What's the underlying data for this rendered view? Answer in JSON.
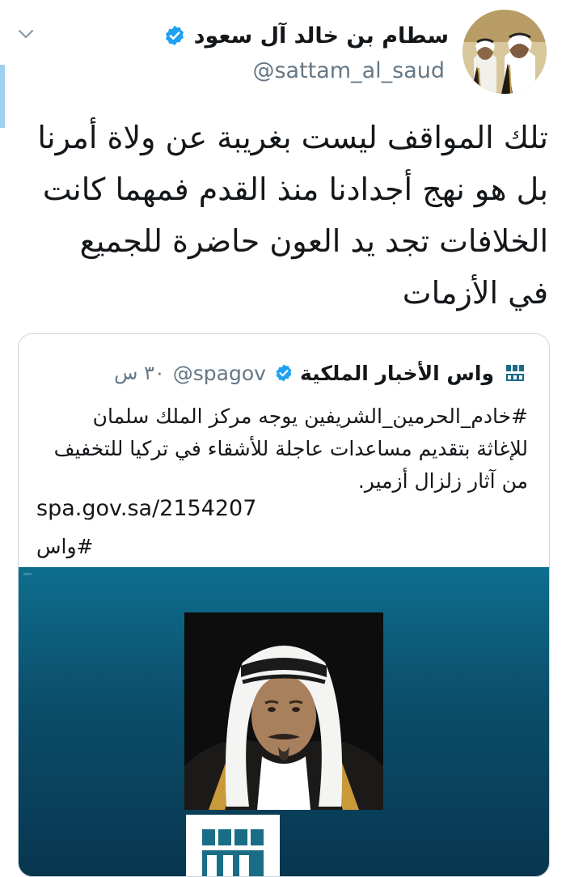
{
  "tweet": {
    "author": {
      "display_name": "سطام بن خالد آل سعود",
      "handle": "@sattam_al_saud",
      "verified": true
    },
    "text": "تلك المواقف ليست بغريبة عن ولاة أمرنا بل هو نهج أجدادنا منذ القدم فمهما كانت الخلافات تجد يد العون حاضرة للجميع في الأزمات",
    "menu_icon": "chevron-down-icon"
  },
  "quoted_tweet": {
    "author": {
      "display_name": "واس الأخبار الملكية",
      "handle": "@spagov",
      "verified": true,
      "logo": "spa-logo"
    },
    "time": "٣٠ س",
    "text": "#خادم_الحرمين_الشريفين يوجه مركز الملك سلمان للإغاثة بتقديم مساعدات عاجلة للأشقاء في تركيا للتخفيف من آثار زلزال أزمير.",
    "link": "spa.gov.sa/2154207",
    "hashtag": "#واس",
    "media": {
      "type": "image",
      "description_icon": "portrait-image",
      "badge": "spa-logo"
    }
  },
  "colors": {
    "verified_blue": "#1da1f2",
    "secondary_text": "#657786",
    "border": "#ccd6dd",
    "media_top": "#0e6e8e",
    "media_bottom": "#08364f",
    "accent_bar": "#9fd0f0"
  }
}
